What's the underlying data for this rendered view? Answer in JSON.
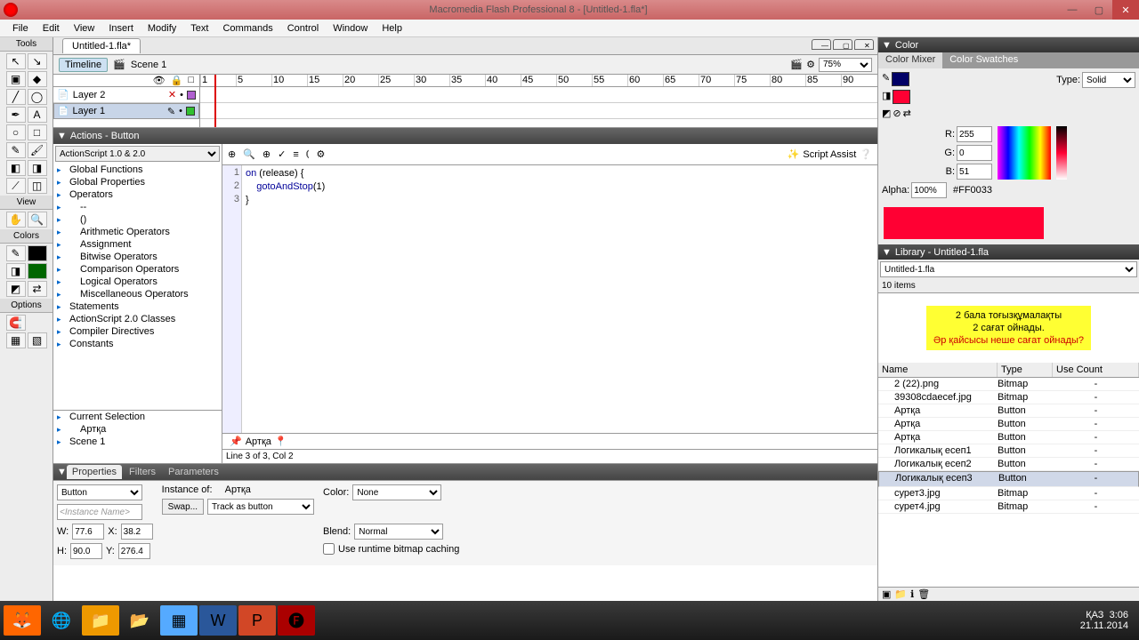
{
  "titlebar": {
    "text": "Macromedia Flash Professional 8 - [Untitled-1.fla*]"
  },
  "menu": [
    "File",
    "Edit",
    "View",
    "Insert",
    "Modify",
    "Text",
    "Commands",
    "Control",
    "Window",
    "Help"
  ],
  "tools": {
    "header": "Tools",
    "view": "View",
    "colors": "Colors",
    "options": "Options"
  },
  "doc": {
    "tab": "Untitled-1.fla*",
    "timeline_btn": "Timeline",
    "scene": "Scene 1",
    "zoom": "75%"
  },
  "layers": [
    {
      "name": "Layer 2",
      "dot": "#b060d0"
    },
    {
      "name": "Layer 1",
      "dot": "#30c030"
    }
  ],
  "ruler": [
    "1",
    "5",
    "10",
    "15",
    "20",
    "25",
    "30",
    "35",
    "40",
    "45",
    "50",
    "55",
    "60",
    "65",
    "70",
    "75",
    "80",
    "85",
    "90"
  ],
  "actions": {
    "title": "Actions - Button",
    "version": "ActionScript 1.0 & 2.0",
    "tree": [
      "Global Functions",
      "Global Properties",
      "Operators",
      "--",
      "()",
      "Arithmetic Operators",
      "Assignment",
      "Bitwise Operators",
      "Comparison Operators",
      "Logical Operators",
      "Miscellaneous Operators",
      "Statements",
      "ActionScript 2.0 Classes",
      "Compiler Directives",
      "Constants"
    ],
    "treeBottom": [
      "Current Selection",
      "Артқа",
      "Scene 1"
    ],
    "script_assist": "Script Assist",
    "code": {
      "l1a": "on",
      "l1b": " (release) {",
      "l2a": "gotoAndStop",
      "l2b": "(1)",
      "l3": "}"
    },
    "codetab": "Артқа",
    "status": "Line 3 of 3, Col 2"
  },
  "props": {
    "tabs": [
      "Properties",
      "Filters",
      "Parameters"
    ],
    "type": "Button",
    "instance_lbl": "Instance of:",
    "instance_val": "Артқа",
    "instance_name": "<Instance Name>",
    "swap": "Swap...",
    "track": "Track as button",
    "color_lbl": "Color:",
    "color_val": "None",
    "blend_lbl": "Blend:",
    "blend_val": "Normal",
    "cache": "Use runtime bitmap caching",
    "w_lbl": "W:",
    "w": "77.6",
    "x_lbl": "X:",
    "x": "38.2",
    "h_lbl": "H:",
    "h": "90.0",
    "y_lbl": "Y:",
    "y": "276.4"
  },
  "color": {
    "title": "Color",
    "tab1": "Color Mixer",
    "tab2": "Color Swatches",
    "type_lbl": "Type:",
    "type_val": "Solid",
    "r_lbl": "R:",
    "r": "255",
    "g_lbl": "G:",
    "g": "0",
    "b_lbl": "B:",
    "b": "51",
    "alpha_lbl": "Alpha:",
    "alpha": "100%",
    "hex": "#FF0033"
  },
  "library": {
    "title": "Library - Untitled-1.fla",
    "file": "Untitled-1.fla",
    "count": "10 items",
    "preview": {
      "l1": "2 бала тоғызқұмалақты",
      "l2": "2 сағат ойнады.",
      "l3": "Әр қайсысы неше сағат ойнады?"
    },
    "cols": [
      "Name",
      "Type",
      "Use Count"
    ],
    "items": [
      {
        "n": "2 (22).png",
        "t": "Bitmap",
        "u": "-"
      },
      {
        "n": "39308cdaecef.jpg",
        "t": "Bitmap",
        "u": "-"
      },
      {
        "n": "Артқа",
        "t": "Button",
        "u": "-"
      },
      {
        "n": "Артқа",
        "t": "Button",
        "u": "-"
      },
      {
        "n": "Артқа",
        "t": "Button",
        "u": "-"
      },
      {
        "n": "Логикалық есеп1",
        "t": "Button",
        "u": "-"
      },
      {
        "n": "Логикалық есеп2",
        "t": "Button",
        "u": "-"
      },
      {
        "n": "Логикалық есеп3",
        "t": "Button",
        "u": "-",
        "sel": true
      },
      {
        "n": "сурет3.jpg",
        "t": "Bitmap",
        "u": "-"
      },
      {
        "n": "сурет4.jpg",
        "t": "Bitmap",
        "u": "-"
      }
    ]
  },
  "taskbar": {
    "lang": "ҚАЗ",
    "time": "3:06",
    "date": "21.11.2014"
  }
}
